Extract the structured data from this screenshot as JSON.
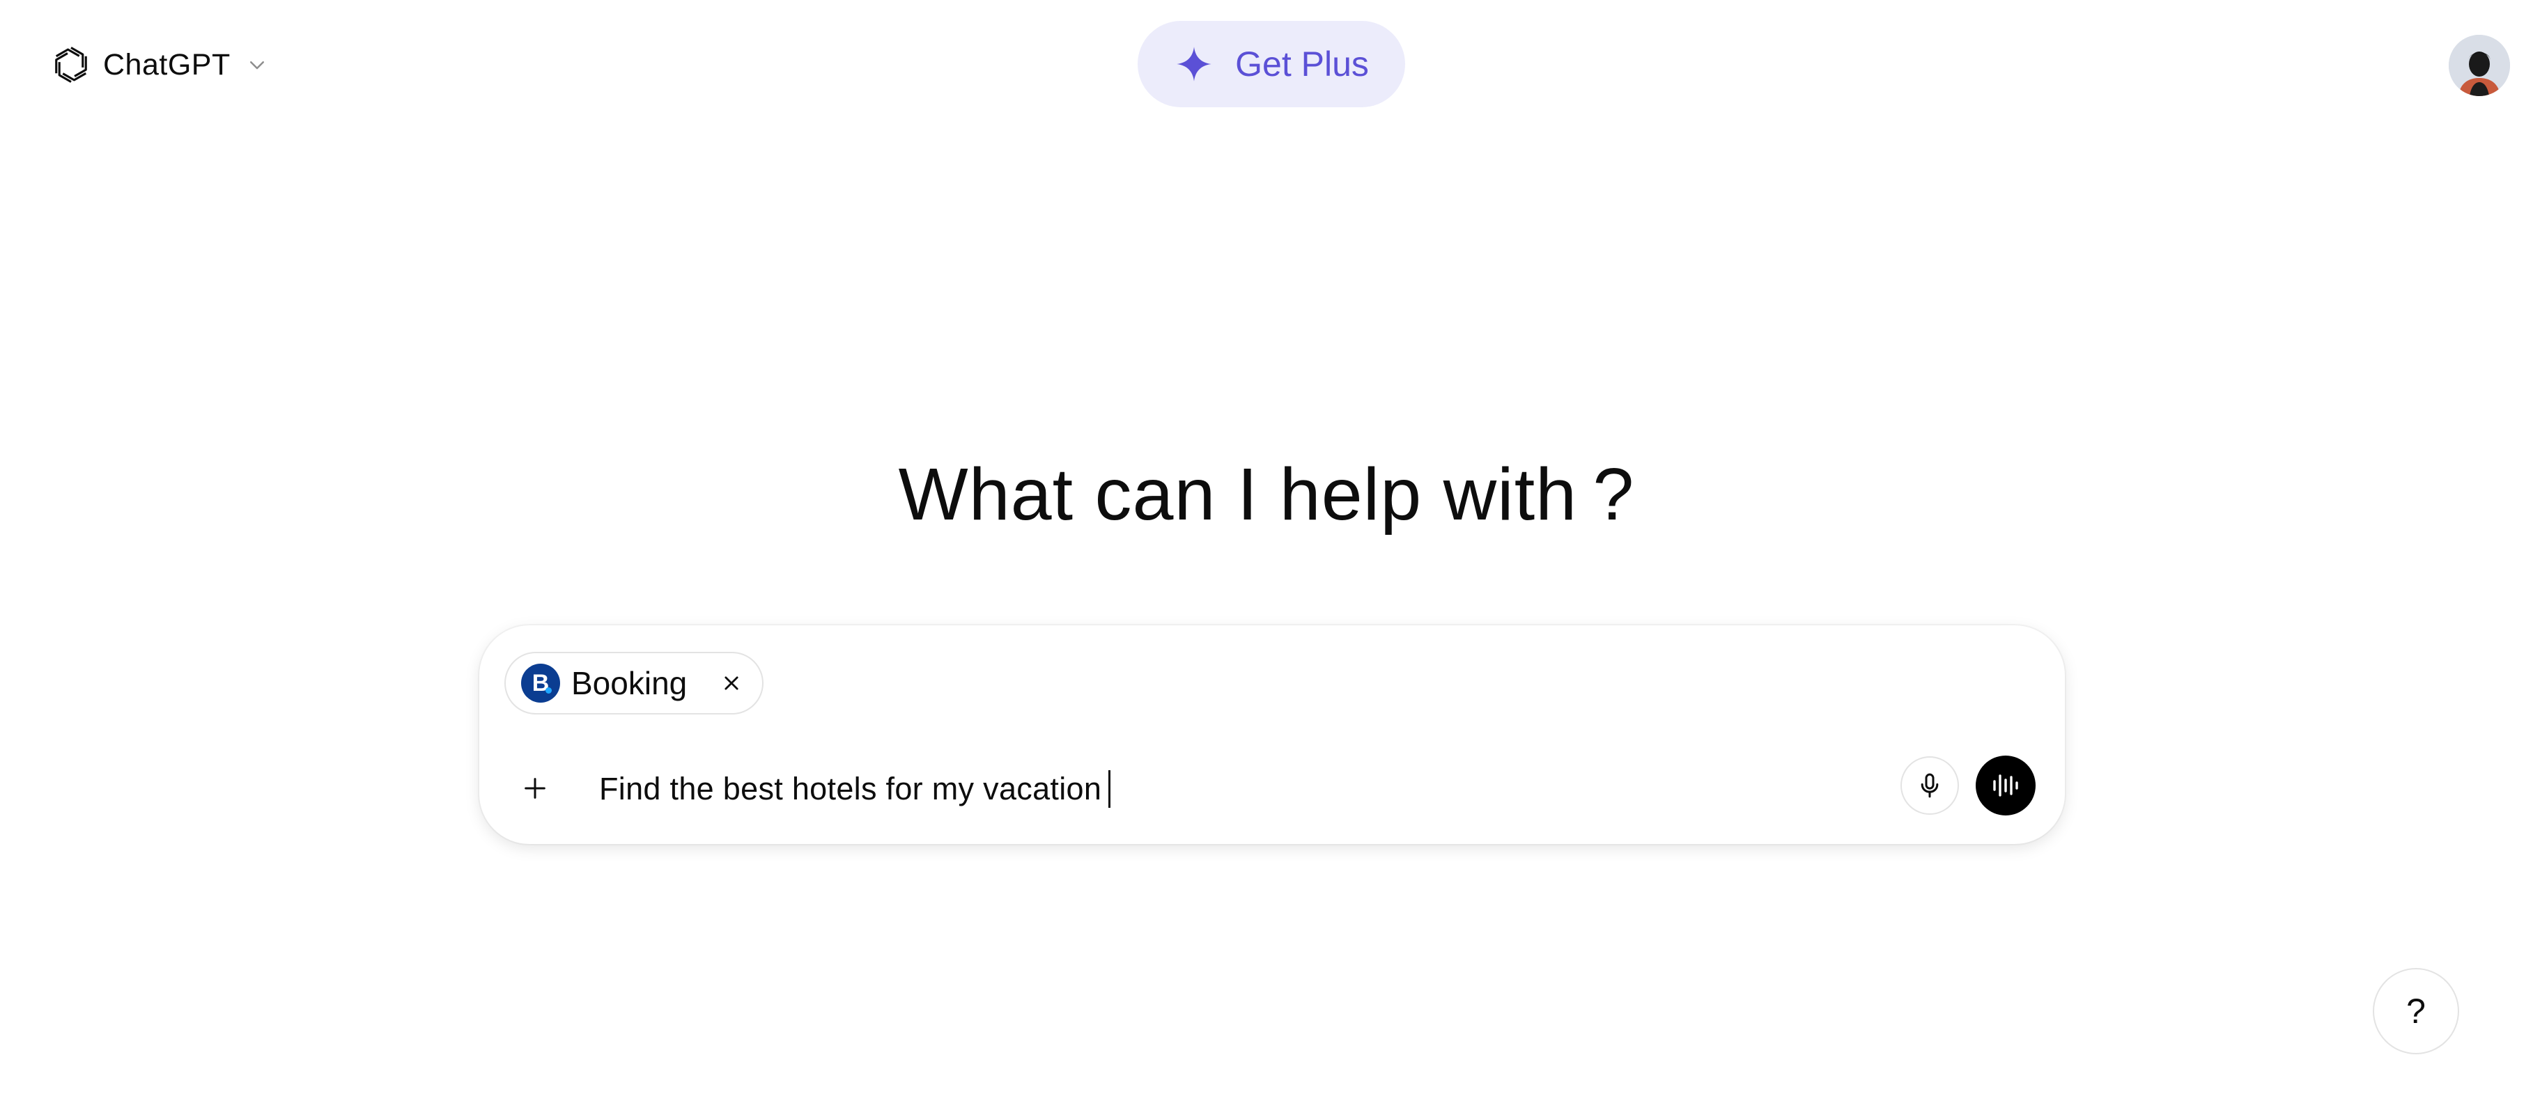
{
  "header": {
    "model_name": "ChatGPT",
    "upgrade_label": "Get Plus"
  },
  "main": {
    "heading": "What can I help with ?"
  },
  "composer": {
    "app_chip": {
      "label": "Booking",
      "icon_letter": "B",
      "brand_color": "#0b3d91"
    },
    "prompt_text": "Find the best hotels for my vacation"
  },
  "help": {
    "label": "?"
  },
  "colors": {
    "accent": "#5b50d6",
    "accent_bg": "#ececfb",
    "border": "#e3e3e3"
  },
  "icons": {
    "logo": "openai-logo-icon",
    "chevron": "chevron-down-icon",
    "sparkle": "sparkle-icon",
    "close": "close-icon",
    "plus": "plus-icon",
    "mic": "microphone-icon",
    "voice": "voice-waveform-icon"
  }
}
